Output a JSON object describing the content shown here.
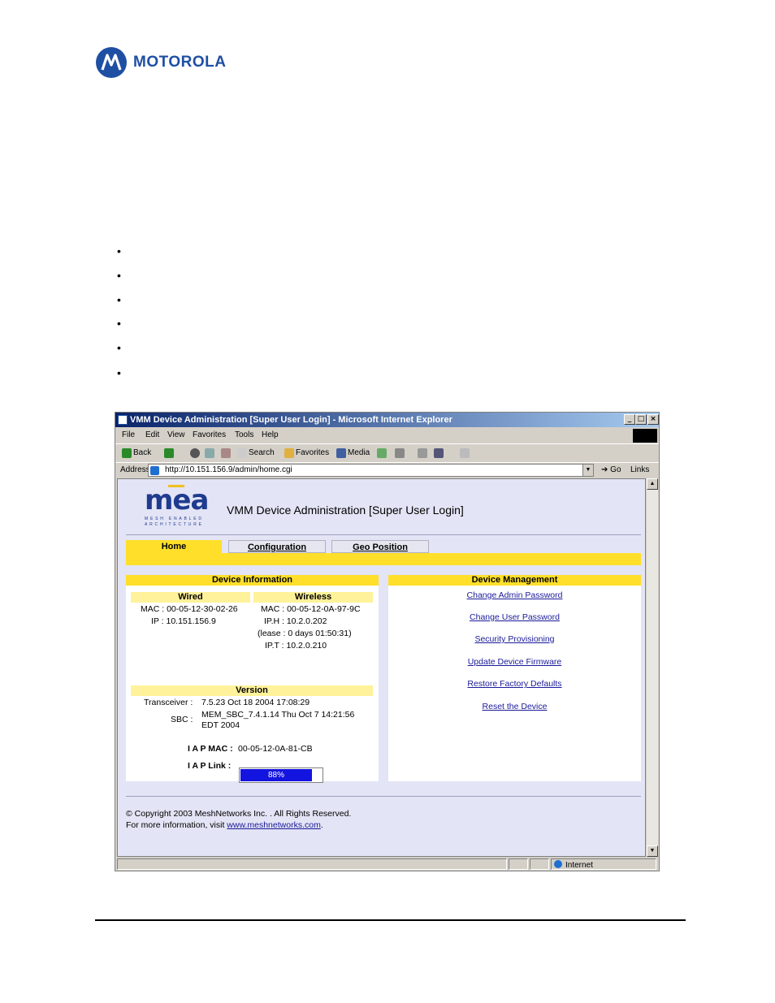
{
  "header": {
    "brand": "MOTOROLA"
  },
  "bullets": [
    "•",
    "•",
    "•",
    "•",
    "•",
    "•"
  ],
  "browser": {
    "title": "VMM Device Administration [Super User Login] - Microsoft Internet Explorer",
    "menu": [
      "File",
      "Edit",
      "View",
      "Favorites",
      "Tools",
      "Help"
    ],
    "toolbar": {
      "back": "Back",
      "search": "Search",
      "favorites": "Favorites",
      "media": "Media"
    },
    "address": {
      "label": "Address",
      "url": "http://10.151.156.9/admin/home.cgi",
      "go": "Go",
      "links": "Links"
    },
    "status": {
      "zone": "Internet"
    }
  },
  "page": {
    "logo": "mea",
    "logo_sub": "MESH ENABLED ARCHITECTURE",
    "title": "VMM Device Administration [Super User Login]",
    "tabs": [
      "Home",
      "Configuration",
      "Geo Position"
    ],
    "device_info": {
      "heading": "Device Information",
      "wired": {
        "heading": "Wired",
        "mac": "MAC : 00-05-12-30-02-26",
        "ip": "IP : 10.151.156.9"
      },
      "wireless": {
        "heading": "Wireless",
        "mac": "MAC : 00-05-12-0A-97-9C",
        "iph": "IP.H : 10.2.0.202",
        "lease": "(lease : 0 days 01:50:31)",
        "ipt": "IP.T : 10.2.0.210"
      },
      "version": {
        "heading": "Version",
        "transceiver_label": "Transceiver :",
        "transceiver_value": "7.5.23 Oct 18 2004 17:08:29",
        "sbc_label": "SBC :",
        "sbc_value_1": "MEM_SBC_7.4.1.14 Thu Oct 7 14:21:56",
        "sbc_value_2": "EDT 2004"
      },
      "iap_mac_label": "I A P MAC :",
      "iap_mac_value": "00-05-12-0A-81-CB",
      "iap_link_label": "I A P Link :",
      "iap_link_percent": 88,
      "iap_link_text": "88%"
    },
    "device_mgmt": {
      "heading": "Device Management",
      "links": [
        "Change Admin Password",
        "Change User Password",
        "Security Provisioning",
        "Update Device Firmware",
        "Restore Factory Defaults",
        "Reset the Device"
      ]
    },
    "footer": {
      "copyright": "© Copyright 2003 MeshNetworks Inc. . All Rights Reserved.",
      "more_prefix": "For more information, visit ",
      "more_link": "www.meshnetworks.com",
      "more_suffix": "."
    }
  },
  "colors": {
    "accent_yellow": "#ffdf2a",
    "page_bg": "#e3e4f5",
    "link_blue": "#1a1a9a",
    "progress_blue": "#1414e0"
  }
}
